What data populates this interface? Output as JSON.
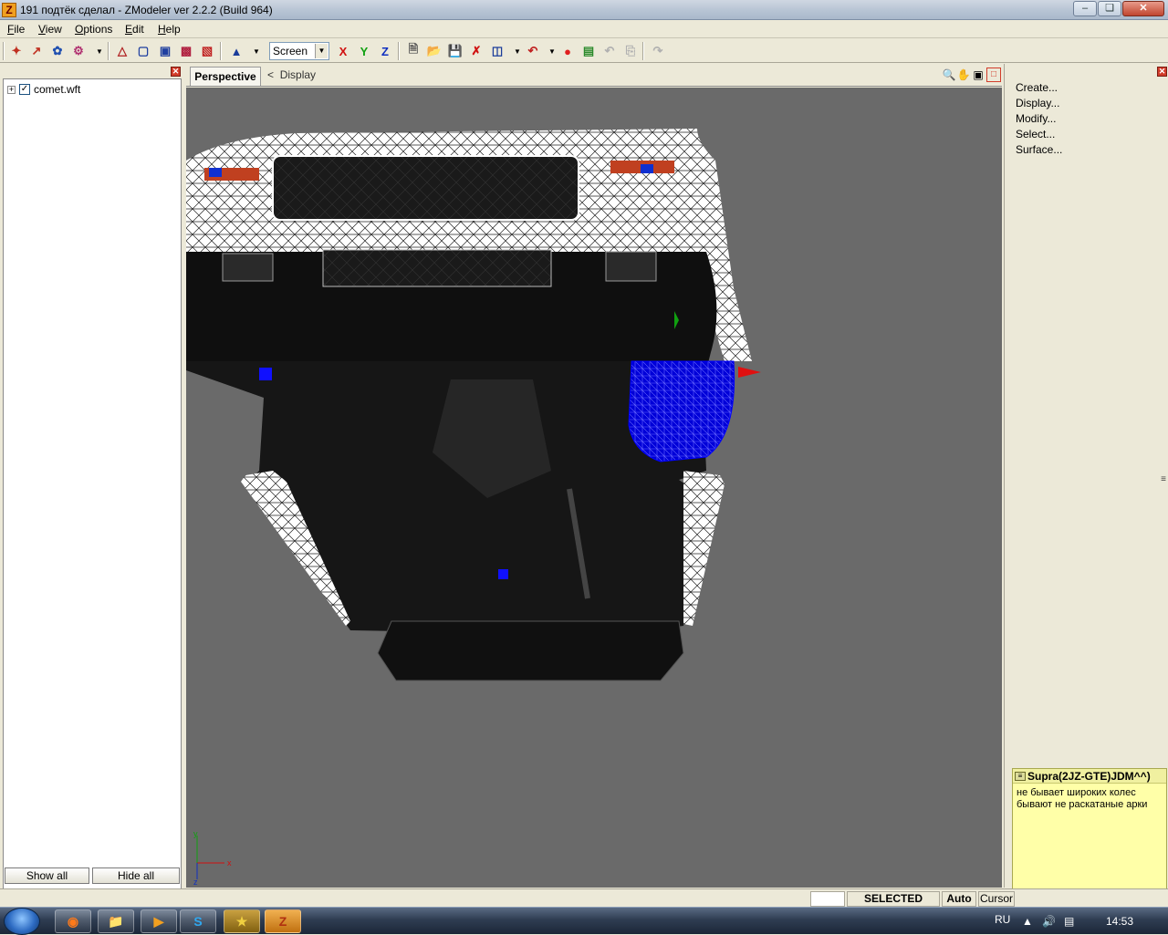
{
  "window": {
    "title": "191 подтёк сделал - ZModeler ver 2.2.2 (Build 964)",
    "app_icon_letter": "Z",
    "controls": [
      "minimize",
      "restore",
      "close"
    ]
  },
  "menu": [
    "File",
    "View",
    "Options",
    "Edit",
    "Help"
  ],
  "toolbar": {
    "coord_space": "Screen",
    "axis_x": "X",
    "axis_y": "Y",
    "axis_z": "Z"
  },
  "tree": {
    "items": [
      {
        "label": "comet.wft",
        "checked": true
      }
    ]
  },
  "left_buttons": {
    "show_all": "Show all",
    "hide_all": "Hide all"
  },
  "viewport": {
    "tab_label": "Perspective",
    "crumb_arrow": "<",
    "crumb_label": "Display",
    "axis_gizmo": {
      "y": "y",
      "x": "x",
      "z": "z"
    }
  },
  "commands": [
    "Create...",
    "Display...",
    "Modify...",
    "Select...",
    "Surface..."
  ],
  "note": {
    "title": "Supra(2JZ-GTE)JDM^^)",
    "line1": "не бывает широких колес",
    "line2": "бывают не раскатаные арки"
  },
  "status": {
    "mode": "SELECTED MODE",
    "auto": "Auto",
    "cursor": "Cursor"
  },
  "taskbar": {
    "language": "RU",
    "time": "14:53"
  },
  "colors": {
    "viewport_bg": "#6a6a6a",
    "note_bg": "#ffffa8",
    "selection_blue": "#0000ff"
  }
}
